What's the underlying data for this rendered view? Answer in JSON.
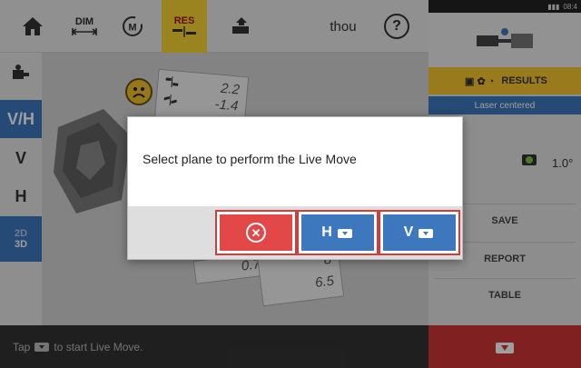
{
  "toolbar": {
    "dim_label": "DIM",
    "res_label": "RES",
    "units": "thou",
    "help": "?"
  },
  "sidemenu": {
    "vh": "V/H",
    "v": "V",
    "h": "H",
    "mode_2d": "2D",
    "mode_3d": "3D"
  },
  "scene": {
    "values_top": [
      "2.2",
      "-1.4"
    ],
    "value_bottom_left": "0.7",
    "values_bottom_right": [
      "8",
      "6.5"
    ]
  },
  "rightpanel": {
    "results_label": "RESULTS",
    "laser_status": "Laser centered",
    "sensor_angle": "1.0°",
    "save": "SAVE",
    "report": "REPORT",
    "table": "TABLE",
    "clock": "08:4"
  },
  "hint": {
    "prefix": "Tap",
    "suffix": "to start Live Move."
  },
  "dialog": {
    "message": "Select plane to perform the Live Move",
    "h_label": "H",
    "v_label": "V"
  },
  "colors": {
    "accent_blue": "#3d78be",
    "accent_yellow": "#f7c630",
    "accent_red": "#d03434"
  }
}
